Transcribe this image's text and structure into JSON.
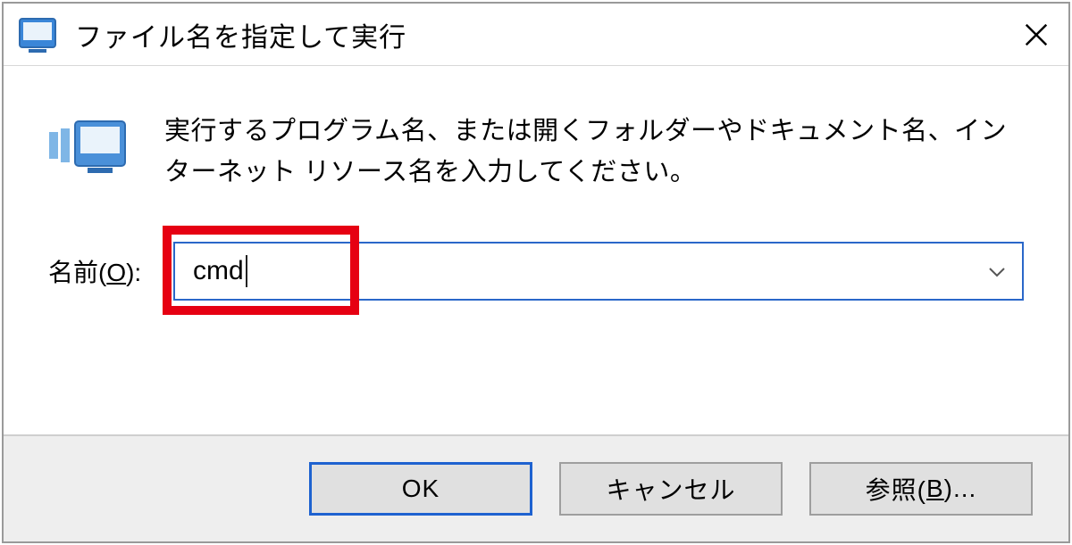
{
  "titlebar": {
    "title": "ファイル名を指定して実行"
  },
  "body": {
    "description": "実行するプログラム名、または開くフォルダーやドキュメント名、インターネット リソース名を入力してください。",
    "input_label_prefix": "名前(",
    "input_label_accel": "O",
    "input_label_suffix": "):",
    "input_value": "cmd"
  },
  "footer": {
    "ok": "OK",
    "cancel": "キャンセル",
    "browse_prefix": "参照(",
    "browse_accel": "B",
    "browse_suffix": ")..."
  }
}
